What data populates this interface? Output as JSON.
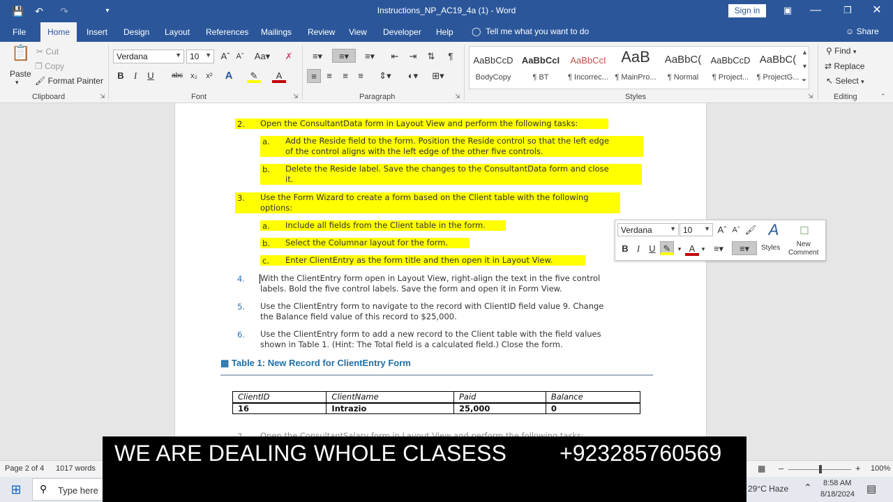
{
  "window": {
    "title": "Instructions_NP_AC19_4a (1)  -  Word",
    "sign_in": "Sign in"
  },
  "tabs": [
    "File",
    "Home",
    "Insert",
    "Design",
    "Layout",
    "References",
    "Mailings",
    "Review",
    "View",
    "Developer",
    "Help"
  ],
  "tell_me": "Tell me what you want to do",
  "share": "Share",
  "ribbon": {
    "clipboard": {
      "paste": "Paste",
      "cut": "Cut",
      "copy": "Copy",
      "format_painter": "Format Painter",
      "label": "Clipboard"
    },
    "font": {
      "name": "Verdana",
      "size": "10",
      "label": "Font"
    },
    "paragraph": {
      "label": "Paragraph"
    },
    "styles": {
      "label": "Styles",
      "items": [
        {
          "sample": "AaBbCcD",
          "name": "BodyCopy"
        },
        {
          "sample": "AaBbCcI",
          "name": "¶ BT"
        },
        {
          "sample": "AaBbCcI",
          "name": "¶ Incorrec..."
        },
        {
          "sample": "AaB",
          "name": "¶ MainPro..."
        },
        {
          "sample": "AaBbC(",
          "name": "¶ Normal"
        },
        {
          "sample": "AaBbCcD",
          "name": "¶ Project..."
        },
        {
          "sample": "AaBbC(",
          "name": "¶ ProjectG..."
        }
      ]
    },
    "editing": {
      "find": "Find",
      "replace": "Replace",
      "select": "Select",
      "label": "Editing"
    }
  },
  "document": {
    "items": [
      {
        "num": "2.",
        "lines": [
          "Open the ConsultantData form in Layout View and perform the following tasks:"
        ]
      },
      {
        "num": "a.",
        "lines": [
          "Add the Reside field to the form. Position the Reside control so that the left edge",
          "of the control aligns with the left edge of the other five controls."
        ]
      },
      {
        "num": "b.",
        "lines": [
          "Delete the Reside label. Save the changes to the ConsultantData form and close",
          "it."
        ]
      },
      {
        "num": "3.",
        "lines": [
          "Use the Form Wizard to create a form based on the Client table with the following",
          "options:"
        ]
      },
      {
        "num": "a.",
        "lines": [
          "Include all fields from the Client table in the form."
        ]
      },
      {
        "num": "b.",
        "lines": [
          "Select the Columnar layout for the form."
        ]
      },
      {
        "num": "c.",
        "lines": [
          "Enter ClientEntry as the form title and then open it in Layout View."
        ]
      },
      {
        "num": "4.",
        "lines": [
          "With the ClientEntry form open in Layout View, right-align the text in the five control",
          "labels. Bold the five control labels. Save the form and open it in Form View."
        ]
      },
      {
        "num": "5.",
        "lines": [
          "Use the ClientEntry form to navigate to the record with ClientID field value 9. Change",
          "the Balance field value of this record to $25,000."
        ]
      },
      {
        "num": "6.",
        "lines": [
          "Use the ClientEntry form to add a new record to the Client table with the field values",
          "shown in Table 1. (Hint: The Total field is a calculated field.) Close the form."
        ]
      }
    ],
    "caption": "Table 1: New Record for ClientEntry Form",
    "table": {
      "headers": [
        "ClientID",
        "ClientName",
        "Paid",
        "Balance"
      ],
      "row": [
        "16",
        "Intrazio",
        "25,000",
        "0"
      ]
    },
    "cutoff_line": "Open the ConsultantSalary form in Layout View and perform the following tasks:"
  },
  "mini_toolbar": {
    "font": "Verdana",
    "size": "10",
    "styles": "Styles",
    "new_comment": "New\nComment"
  },
  "status": {
    "page": "Page 2 of 4",
    "words": "1017 words",
    "zoom": "100%"
  },
  "taskbar": {
    "search": "Type here",
    "weather": "29°C  Haze",
    "time": "8:58 AM",
    "date": "8/18/2024"
  },
  "banner": {
    "text": "WE ARE DEALING WHOLE CLASESS",
    "phone": "+923285760569"
  }
}
